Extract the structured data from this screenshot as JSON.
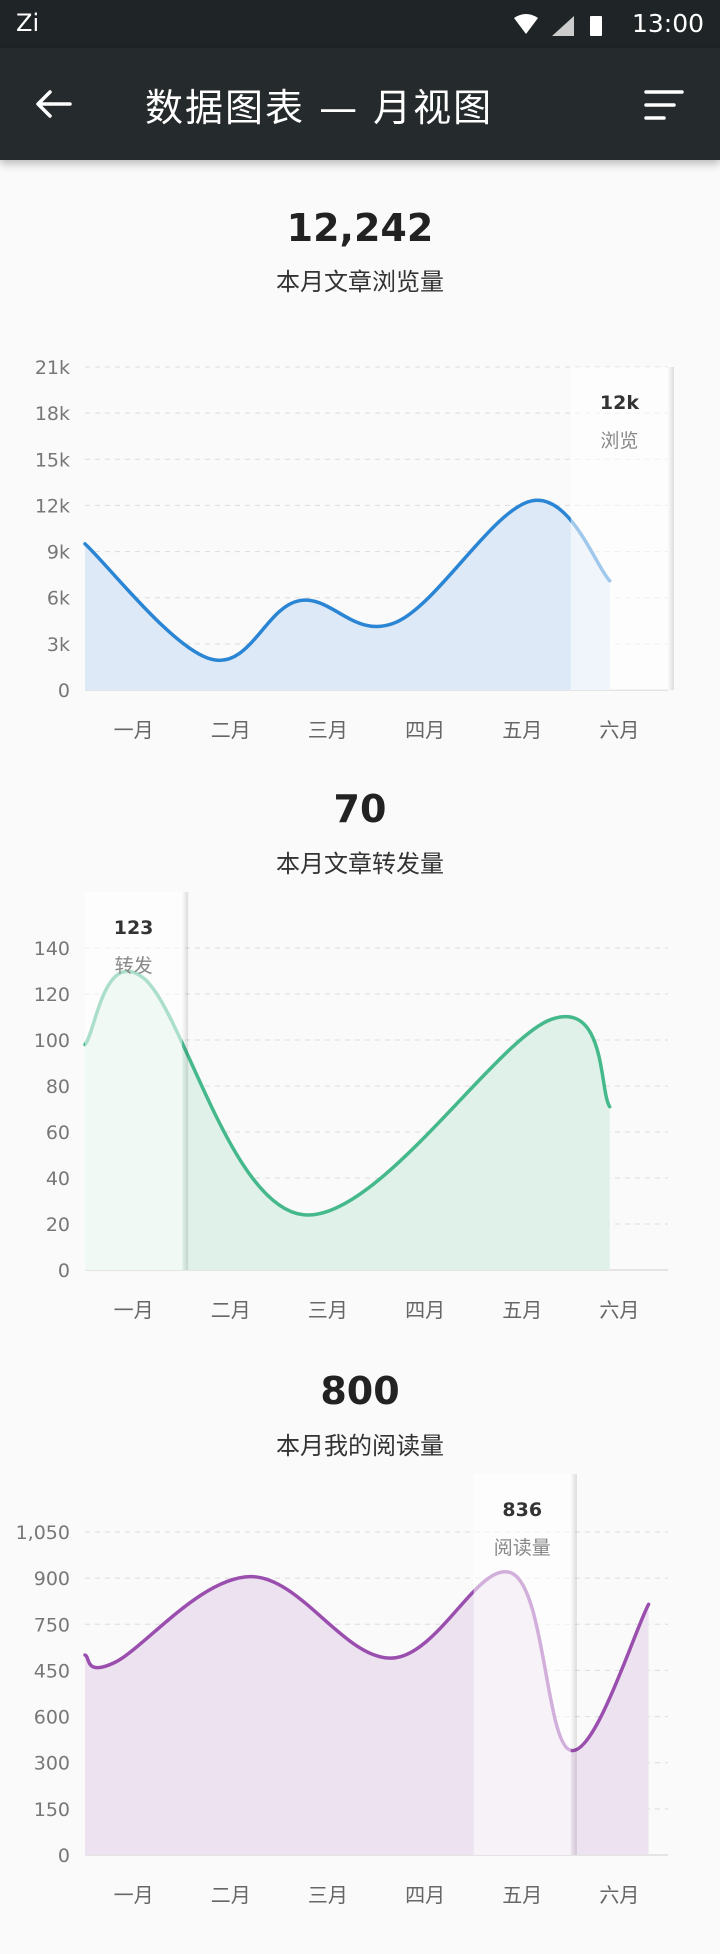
{
  "status_bar": {
    "left_label": "Zi",
    "time": "13:00"
  },
  "app_bar": {
    "title": "数据图表 — 月视图"
  },
  "charts": [
    {
      "metric_value": "12,242",
      "metric_label": "本月文章浏览量",
      "color": "#2a85d4",
      "fill": "#dde9f7",
      "tooltip": {
        "value": "12k",
        "label": "浏览"
      }
    },
    {
      "metric_value": "70",
      "metric_label": "本月文章转发量",
      "color": "#46b98c",
      "fill": "#dff1e9",
      "tooltip": {
        "value": "123",
        "label": "转发"
      }
    },
    {
      "metric_value": "800",
      "metric_label": "本月我的阅读量",
      "color": "#9a4fae",
      "fill": "#ede2f0",
      "tooltip": {
        "value": "836",
        "label": "阅读量"
      }
    }
  ],
  "chart_data": [
    {
      "type": "area",
      "categories": [
        "一月",
        "二月",
        "三月",
        "四月",
        "五月",
        "六月"
      ],
      "y_ticks": [
        "0",
        "3k",
        "6k",
        "9k",
        "12k",
        "15k",
        "18k",
        "21k"
      ],
      "ylim": [
        0,
        21000
      ],
      "x": [
        0,
        1.3,
        2.2,
        3.2,
        4.6,
        5.4
      ],
      "values": [
        9500,
        2000,
        5800,
        4400,
        12300,
        7100
      ],
      "highlight_index": 5
    },
    {
      "type": "area",
      "categories": [
        "一月",
        "二月",
        "三月",
        "四月",
        "五月",
        "六月"
      ],
      "y_ticks": [
        "0",
        "20",
        "40",
        "60",
        "80",
        "100",
        "120",
        "140"
      ],
      "ylim": [
        0,
        140
      ],
      "x": [
        0,
        0.6,
        2.25,
        4.8,
        5.4
      ],
      "values": [
        98,
        127,
        24,
        109,
        71
      ],
      "highlight_index": 0
    },
    {
      "type": "area",
      "categories": [
        "一月",
        "二月",
        "三月",
        "四月",
        "五月",
        "六月"
      ],
      "y_ticks": [
        "0",
        "150",
        "300",
        "600",
        "450",
        "750",
        "900",
        "1,050"
      ],
      "ylim": [
        0,
        1050
      ],
      "x": [
        0,
        0.3,
        1.7,
        3.15,
        4.4,
        5.0,
        5.8
      ],
      "values": [
        650,
        625,
        905,
        640,
        915,
        340,
        815
      ],
      "highlight_index": 4
    }
  ]
}
